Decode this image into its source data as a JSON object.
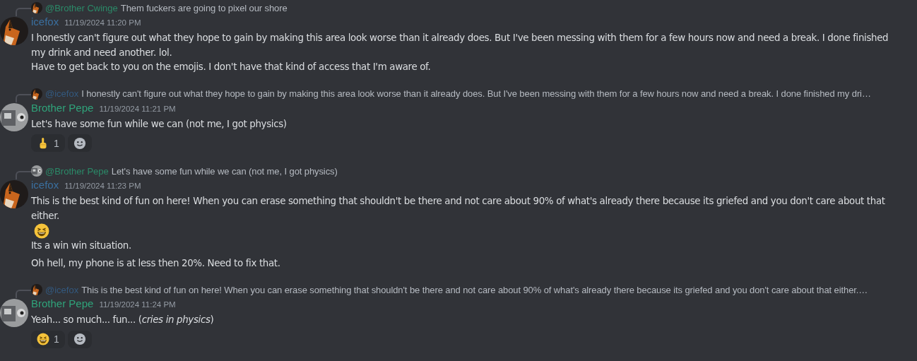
{
  "messages": [
    {
      "reply": {
        "avatar": {
          "kind": "fox"
        },
        "author": "@Brother Cwinge",
        "color": "#2b8a68",
        "text": "Them fuckers are going to pixel our shore"
      },
      "avatar": {
        "kind": "fox"
      },
      "author": "icefox",
      "color": "#3a6f9f",
      "timestamp": "11/19/2024 11:20 PM",
      "paragraphs": [
        {
          "lines": [
            {
              "text": "I honestly can't figure out what they hope to gain by making this area look worse than it already does. But I've been messing with them for a few hours now and need a break. I done finished my drink and need another. lol."
            },
            {
              "text": "Have to get back to you on the emojis. I don't have that kind of access that I'm aware of."
            }
          ]
        }
      ]
    },
    {
      "reply": {
        "avatar": {
          "kind": "fox"
        },
        "author": "@icefox",
        "color": "#33597f",
        "text": "I honestly can't figure out what they hope to gain by making this area look worse than it already does. But I've been messing with them for a few hours now and need a break. I done finished my dri…"
      },
      "avatar": {
        "kind": "pepe"
      },
      "author": "Brother Pepe",
      "color": "#2fa37a",
      "timestamp": "11/19/2024 11:21 PM",
      "paragraphs": [
        {
          "lines": [
            {
              "text": "Let's have some fun while we can (not me, I got physics)"
            }
          ]
        }
      ],
      "reactions": [
        {
          "kind": "point",
          "count": "1"
        },
        {
          "kind": "add"
        }
      ]
    },
    {
      "reply": {
        "avatar": {
          "kind": "pepe"
        },
        "author": "@Brother Pepe",
        "color": "#2b8a68",
        "text": "Let's have some fun while we can (not me, I got physics)"
      },
      "avatar": {
        "kind": "fox"
      },
      "author": "icefox",
      "color": "#3a6f9f",
      "timestamp": "11/19/2024 11:23 PM",
      "paragraphs": [
        {
          "lines": [
            {
              "text": "This is the best kind of fun on here! When you can erase something that shouldn't be there and not care about 90% of what's already there because its griefed and you don't care about that either.",
              "emoji": {
                "kind": "laugh"
              }
            },
            {
              "text": "Its a win win situation."
            }
          ]
        },
        {
          "lines": [
            {
              "text": "Oh hell, my phone is at less then 20%. Need to fix that."
            }
          ]
        }
      ]
    },
    {
      "reply": {
        "avatar": {
          "kind": "fox"
        },
        "author": "@icefox",
        "color": "#33597f",
        "text": "This is the best kind of fun on here! When you can erase something that shouldn't be there and not care about 90% of what's already there because its griefed and you don't care about that either.…"
      },
      "avatar": {
        "kind": "pepe"
      },
      "author": "Brother Pepe",
      "color": "#2fa37a",
      "timestamp": "11/19/2024 11:24 PM",
      "paragraphs": [
        {
          "lines": [
            {
              "text": "Yeah... so much... fun... (*cries in physics*)"
            }
          ]
        }
      ],
      "reactions": [
        {
          "kind": "laugh",
          "count": "1"
        },
        {
          "kind": "add"
        }
      ]
    }
  ]
}
